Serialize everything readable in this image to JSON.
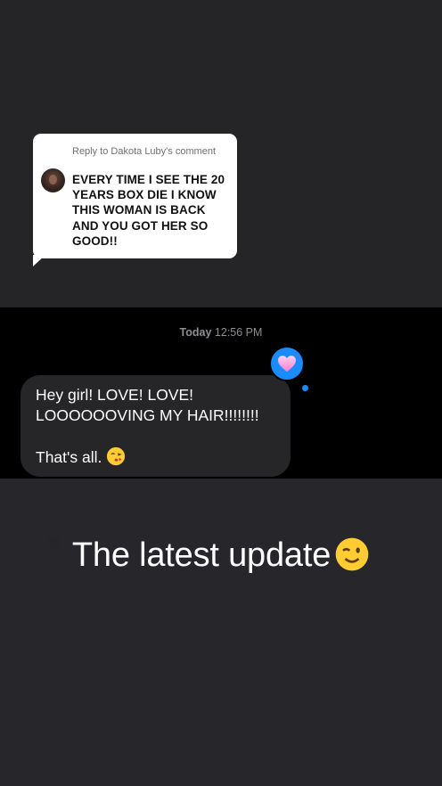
{
  "reply_card": {
    "header": "Reply to Dakota Luby's comment",
    "comment_text": "EVERY TIME I SEE THE 20 YEARS BOX DIE I KNOW THIS WOMAN IS BACK AND YOU GOT HER SO GOOD!!"
  },
  "chat": {
    "timestamp_day": "Today",
    "timestamp_time": "12:56 PM",
    "message_text": "Hey girl! LOVE! LOVE! LOOOOOOVING MY HAIR!!!!!!!!\n\nThat's all.",
    "message_emoji": "kissing-heart-emoji",
    "reaction": "heart-icon",
    "reaction_color": "#1a8cff"
  },
  "caption": {
    "text": "The latest update",
    "emoji": "winking-face-emoji"
  },
  "colors": {
    "background": "#26262b",
    "chat_background": "#000000",
    "bubble": "#262629",
    "card": "#ffffff"
  }
}
